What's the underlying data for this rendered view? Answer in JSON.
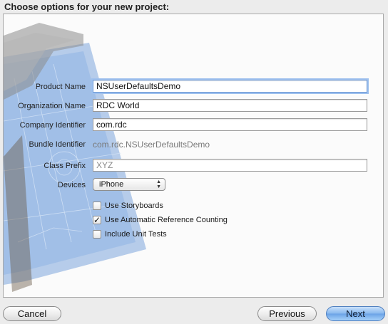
{
  "header": {
    "title": "Choose options for your new project:"
  },
  "form": {
    "product_name": {
      "label": "Product Name",
      "value": "NSUserDefaultsDemo"
    },
    "organization_name": {
      "label": "Organization Name",
      "value": "RDC World"
    },
    "company_identifier": {
      "label": "Company Identifier",
      "value": "com.rdc"
    },
    "bundle_identifier": {
      "label": "Bundle Identifier",
      "value": "com.rdc.NSUserDefaultsDemo"
    },
    "class_prefix": {
      "label": "Class Prefix",
      "placeholder": "XYZ"
    },
    "devices": {
      "label": "Devices",
      "selected": "iPhone"
    },
    "options": [
      {
        "label": "Use Storyboards",
        "checked": false
      },
      {
        "label": "Use Automatic Reference Counting",
        "checked": true
      },
      {
        "label": "Include Unit Tests",
        "checked": false
      }
    ]
  },
  "footer": {
    "cancel_label": "Cancel",
    "previous_label": "Previous",
    "next_label": "Next"
  },
  "colors": {
    "accent": "#6aa2e6",
    "focus_ring": "#9fc1ee",
    "blueprint": "#6f9bd6"
  },
  "icons": {
    "background": "xcode-hammer-blueprint-icon",
    "popup_arrows": "up-down-arrows-icon",
    "check": "checkmark-icon"
  }
}
